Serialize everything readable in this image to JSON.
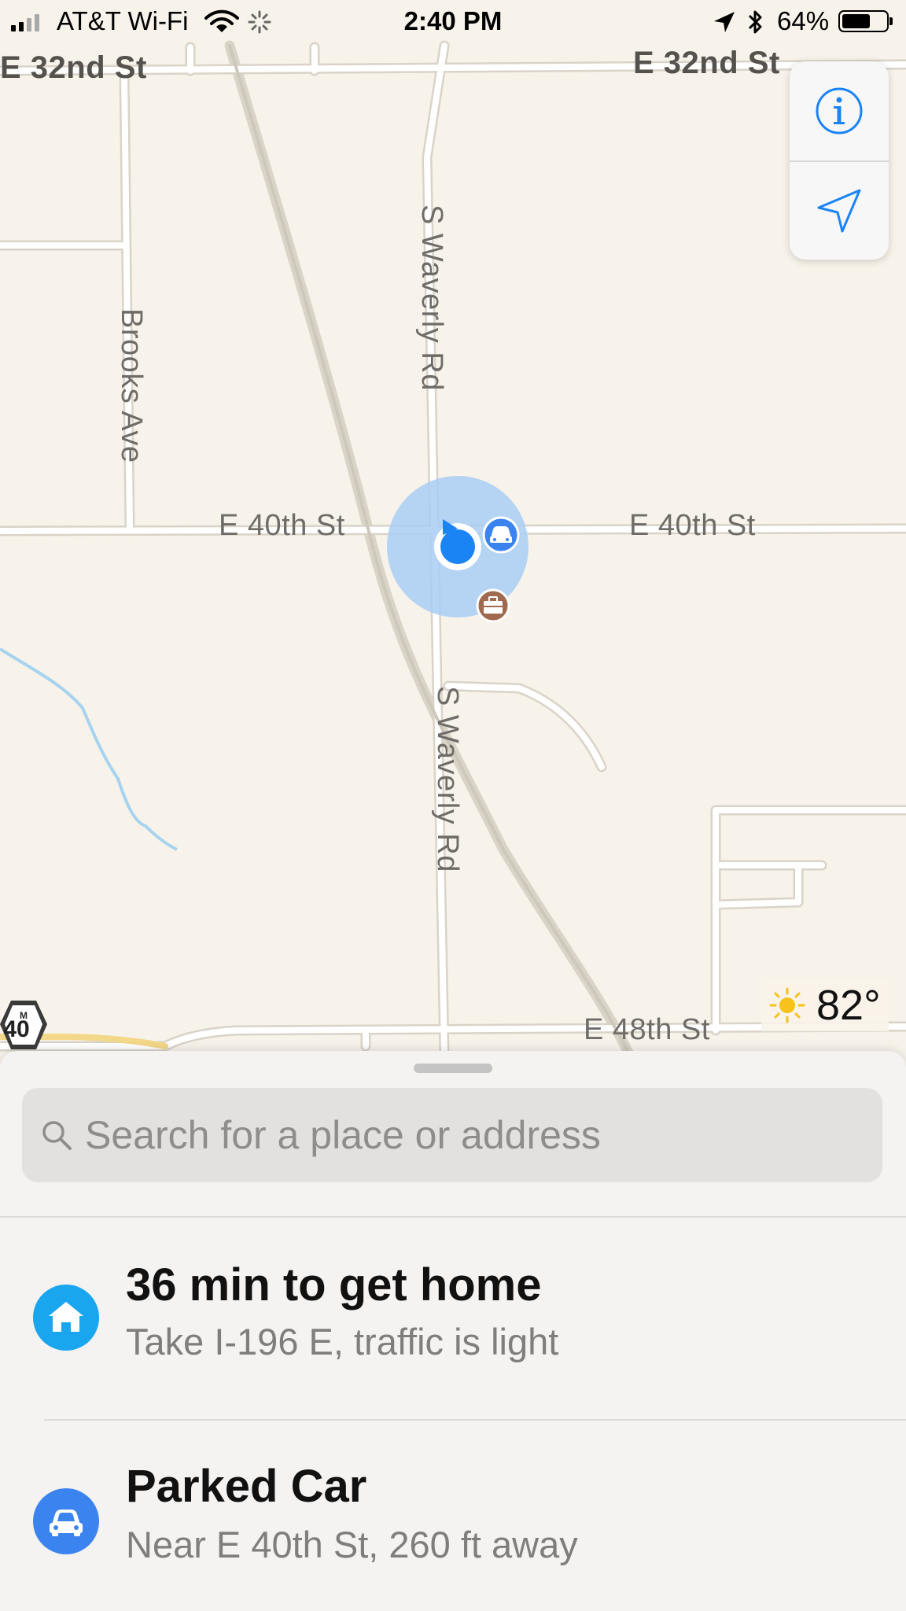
{
  "status_bar": {
    "carrier": "AT&T Wi-Fi",
    "time": "2:40 PM",
    "battery_percent": "64%",
    "battery_level": 0.64,
    "icons": [
      "signal-bars",
      "wifi",
      "activity-spinner",
      "location-arrow",
      "bluetooth",
      "battery"
    ]
  },
  "map": {
    "street_labels": {
      "e32_left": "E 32nd St",
      "e32_right": "E 32nd St",
      "brooks": "Brooks Ave",
      "waverly_north": "S Waverly Rd",
      "waverly_south": "S Waverly Rd",
      "e40_left": "E 40th St",
      "e40_right": "E 40th St",
      "e48": "E 48th St"
    },
    "route_shield": "40",
    "route_shield_prefix": "M",
    "colors": {
      "land": "#f8f3ea",
      "road": "#ffffff",
      "road_edge": "#d9d3c8",
      "water": "#a6d3ef",
      "location_blue": "#1a84f5",
      "location_halo": "#a9cdf4",
      "parked_car_blue": "#3b84f0",
      "work_brown": "#a06a4e"
    },
    "markers": [
      "current-location",
      "parked-car-marker",
      "work-briefcase-marker"
    ]
  },
  "map_controls": {
    "info_icon": "info-icon",
    "locate_icon": "location-arrow-icon"
  },
  "weather": {
    "temperature": "82°",
    "icon": "sun-icon"
  },
  "sheet": {
    "search_placeholder": "Search for a place or address",
    "suggestions": [
      {
        "icon": "home-icon",
        "icon_color": "#1aa5ef",
        "title": "36 min to get home",
        "subtitle": "Take I-196 E, traffic is light"
      },
      {
        "icon": "car-icon",
        "icon_color": "#3b84f0",
        "title": "Parked Car",
        "subtitle": "Near E 40th St, 260 ft away"
      }
    ]
  }
}
